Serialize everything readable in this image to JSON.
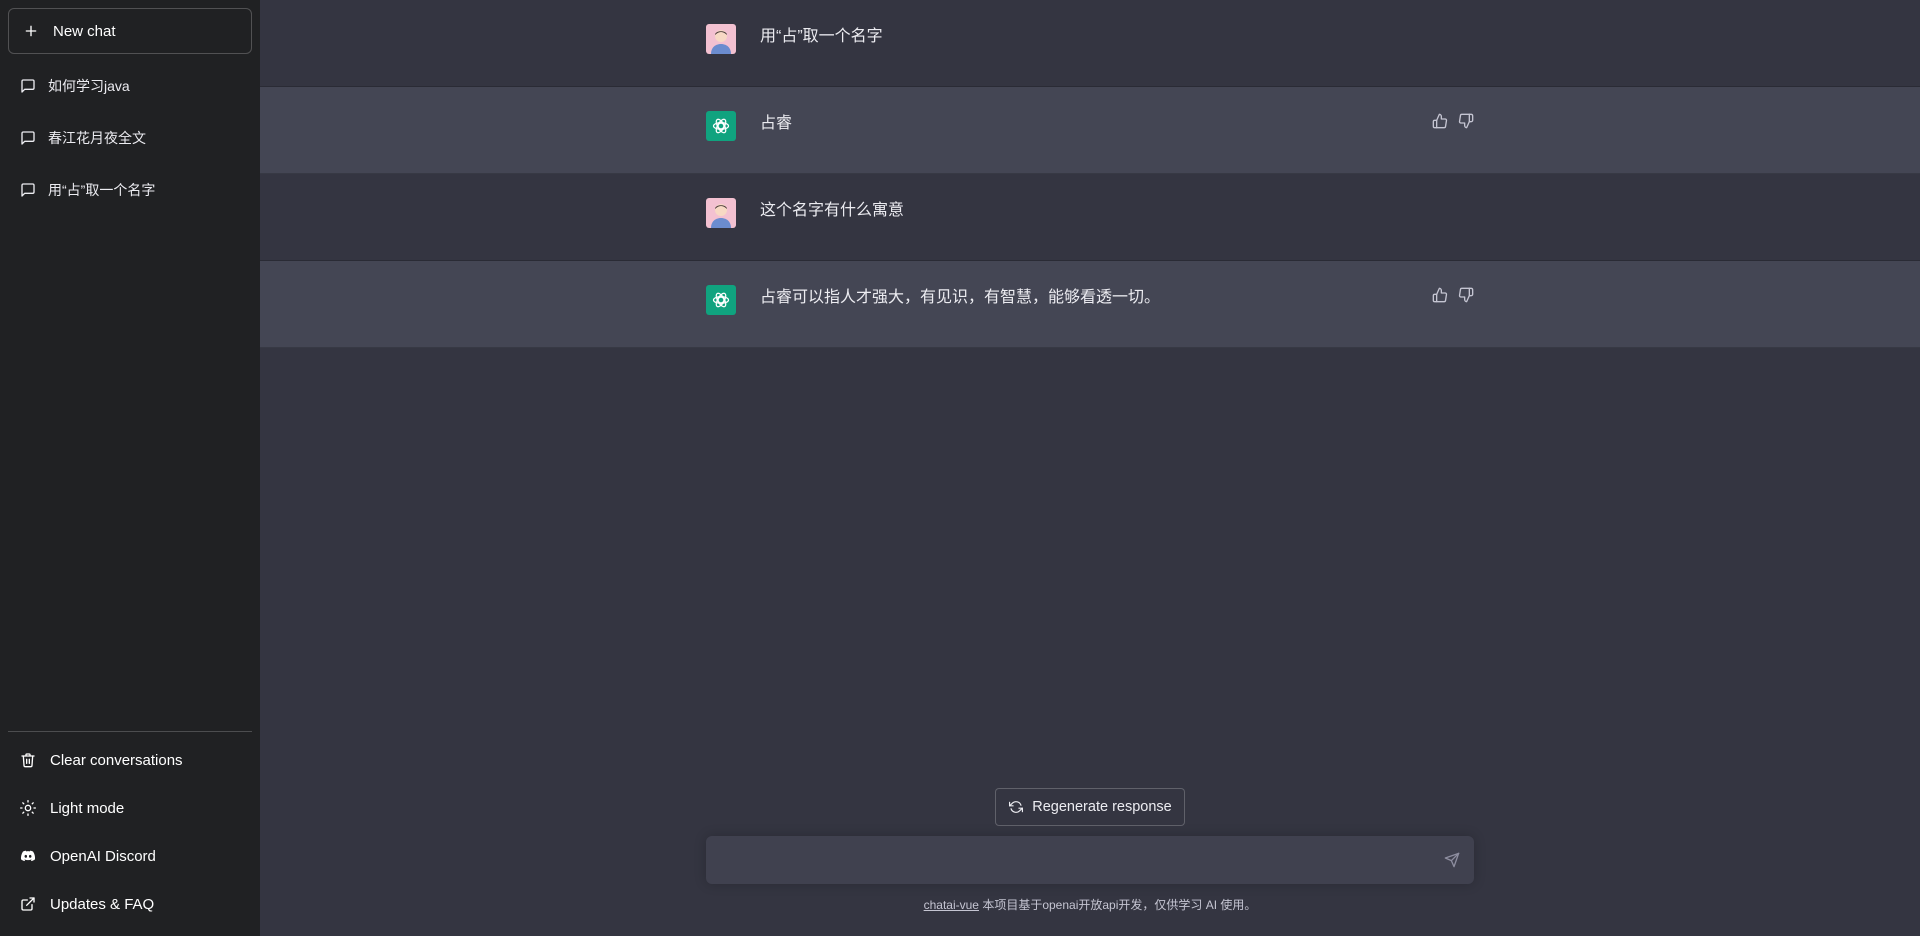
{
  "sidebar": {
    "new_chat_label": "New chat",
    "conversations": [
      {
        "label": "如何学习java"
      },
      {
        "label": "春江花月夜全文"
      },
      {
        "label": "用“占”取一个名字"
      }
    ],
    "actions": {
      "clear": "Clear conversations",
      "light_mode": "Light mode",
      "discord": "OpenAI Discord",
      "updates": "Updates & FAQ"
    }
  },
  "messages": [
    {
      "role": "user",
      "text": "用“占”取一个名字"
    },
    {
      "role": "assistant",
      "text": "占睿"
    },
    {
      "role": "user",
      "text": "这个名字有什么寓意"
    },
    {
      "role": "assistant",
      "text": "占睿可以指人才强大，有见识，有智慧，能够看透一切。"
    }
  ],
  "composer": {
    "regenerate_label": "Regenerate response",
    "input_value": "",
    "input_placeholder": ""
  },
  "footer": {
    "link_text": "chatai-vue",
    "text": " 本项目基于openai开放api开发，仅供学习 AI 使用。"
  },
  "colors": {
    "sidebar_bg": "#202123",
    "main_bg": "#343541",
    "assistant_bg": "#444654",
    "input_bg": "#40414f",
    "brand_green": "#10a37f"
  },
  "icons": {
    "new_chat": "plus-icon",
    "conversation": "chat-bubble-icon",
    "clear": "trash-icon",
    "light_mode": "sun-icon",
    "discord": "discord-icon",
    "updates": "external-link-icon",
    "thumbs_up": "thumbs-up-icon",
    "thumbs_down": "thumbs-down-icon",
    "regenerate": "refresh-icon",
    "send": "paper-plane-icon"
  }
}
